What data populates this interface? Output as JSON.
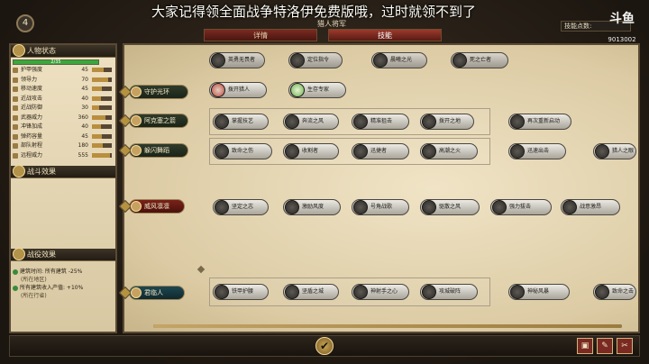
{
  "hud": {
    "counter": "4",
    "banner": "大家记得领全面战争特洛伊免费版哦，过时就领不到了",
    "top_title": "猎人将军",
    "tabs": [
      {
        "label": "详情",
        "active": false
      },
      {
        "label": "技能",
        "active": true
      }
    ],
    "skill_points_label": "技能点数:",
    "skill_points_value": "",
    "watermark": "斗鱼",
    "watermark_id": "9013002"
  },
  "left": {
    "status_header": "人物状态",
    "xp_text": "2/35",
    "stats": [
      {
        "label": "护甲强度",
        "value": "45",
        "level": 0.6
      },
      {
        "label": "领导力",
        "value": "70",
        "level": 0.8
      },
      {
        "label": "移动速度",
        "value": "45",
        "level": 0.5
      },
      {
        "label": "近战攻击",
        "value": "40",
        "level": 0.45
      },
      {
        "label": "近战防御",
        "value": "30",
        "level": 0.35
      },
      {
        "label": "武器威力",
        "value": "360",
        "level": 0.7
      },
      {
        "label": "冲锋加成",
        "value": "40",
        "level": 0.45
      },
      {
        "label": "弹药容量",
        "value": "45",
        "level": 0.5
      },
      {
        "label": "部队射程",
        "value": "180",
        "level": 0.55
      },
      {
        "label": "远程威力",
        "value": "555",
        "level": 0.9
      }
    ],
    "battle_header": "战斗效果",
    "campaign_header": "战役效果",
    "campaign_effects": [
      {
        "text": "建筑时间: 所有建筑 -25%",
        "sub": "(所在地区)"
      },
      {
        "text": "所有建筑收入产值: +10%",
        "sub": "(所在行省)"
      }
    ]
  },
  "tree": {
    "rows": [
      {
        "label": "守护光环",
        "style": "green"
      },
      {
        "label": "阿克塞之箭",
        "style": "green"
      },
      {
        "label": "躲闪舞蹈",
        "style": "green"
      },
      {
        "label": "威风凛凛",
        "style": "red"
      },
      {
        "label": "君临人",
        "style": "teal"
      }
    ],
    "top_nodes": [
      "英勇无畏者",
      "定位指令",
      "晨曦之光",
      "死之亡者"
    ],
    "aura_nodes": [
      "拨开猎人",
      "生存专家"
    ],
    "row2": [
      "掌握技艺",
      "奔流之风",
      "精准狙击",
      "拨开之地",
      "再次重新启动"
    ],
    "row3": [
      "致命之伤",
      "收割者",
      "迅捷者",
      "高潮之火",
      "迅速出击",
      "猎人之眼"
    ],
    "row4": [
      "坚定之志",
      "激励风度",
      "号角战歌",
      "驱散之风",
      "强力拔击",
      "战意激昂"
    ],
    "row5": [
      "铁甲护腰",
      "坚盾之城",
      "神射手之心",
      "攻城破阵",
      "神秘风暴",
      "致命之击"
    ]
  },
  "bottom": {
    "confirm_icon": "✔",
    "buttons": [
      "▣",
      "✎",
      "✂"
    ]
  },
  "colors": {
    "tab_active": "#9b3a2c",
    "panel_bg": "#e6d7b4",
    "xp_green": "#3ca63c"
  }
}
